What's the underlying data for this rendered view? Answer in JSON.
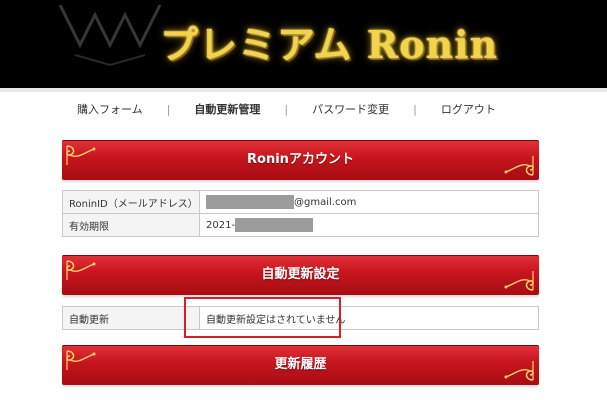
{
  "header": {
    "logo_text": "プレミアム Ronin"
  },
  "nav": {
    "items": [
      {
        "label": "購入フォーム"
      },
      {
        "label": "自動更新管理"
      },
      {
        "label": "パスワード変更"
      },
      {
        "label": "ログアウト"
      }
    ],
    "separator": "|",
    "active_index": 1
  },
  "account_section": {
    "title": "Roninアカウント",
    "rows": [
      {
        "label": "RoninID（メールアドレス）",
        "value": "@gmail.com"
      },
      {
        "label": "有効期限",
        "value": "2021-"
      }
    ]
  },
  "auto_renew_section": {
    "title": "自動更新設定",
    "rows": [
      {
        "label": "自動更新",
        "value": "自動更新設定はされていません"
      }
    ]
  },
  "history_section": {
    "title": "更新履歴"
  },
  "colors": {
    "banner_red": "#c7141c",
    "logo_gold": "#f3d34a",
    "highlight_red": "#d4222b",
    "redaction_gray": "#9c9c9c"
  }
}
